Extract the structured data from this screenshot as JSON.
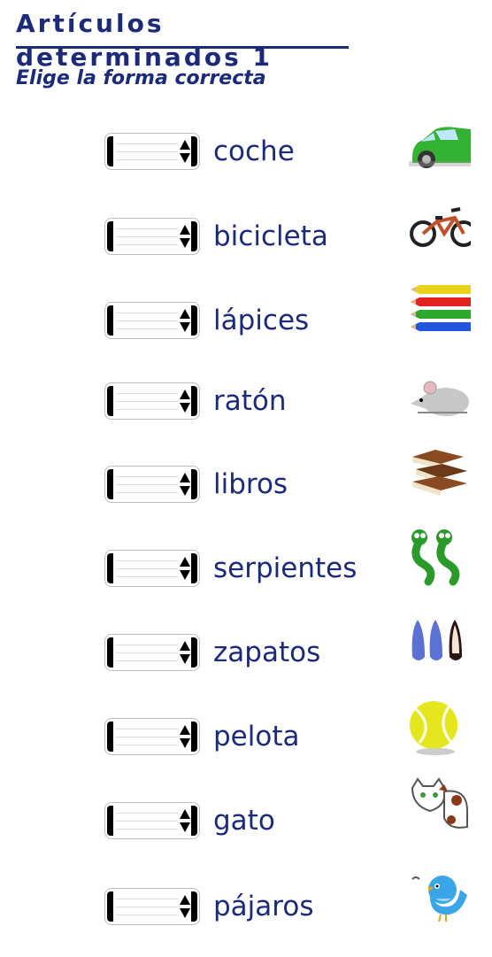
{
  "header": {
    "title": "Artículos determinados 1",
    "subtitle": "Elige la forma correcta"
  },
  "colors": {
    "title": "#1c2a7a",
    "word": "#1c2a7a"
  },
  "rows": [
    {
      "word": "coche",
      "selected": "",
      "icon": "car-icon"
    },
    {
      "word": "bicicleta",
      "selected": "",
      "icon": "bicycle-icon"
    },
    {
      "word": "lápices",
      "selected": "",
      "icon": "pencils-icon"
    },
    {
      "word": "ratón",
      "selected": "",
      "icon": "mouse-icon"
    },
    {
      "word": "libros",
      "selected": "",
      "icon": "books-icon"
    },
    {
      "word": "serpientes",
      "selected": "",
      "icon": "snakes-icon"
    },
    {
      "word": "zapatos",
      "selected": "",
      "icon": "shoes-icon"
    },
    {
      "word": "pelota",
      "selected": "",
      "icon": "ball-icon"
    },
    {
      "word": "gato",
      "selected": "",
      "icon": "cat-icon"
    },
    {
      "word": "pájaros",
      "selected": "",
      "icon": "bird-icon"
    }
  ]
}
